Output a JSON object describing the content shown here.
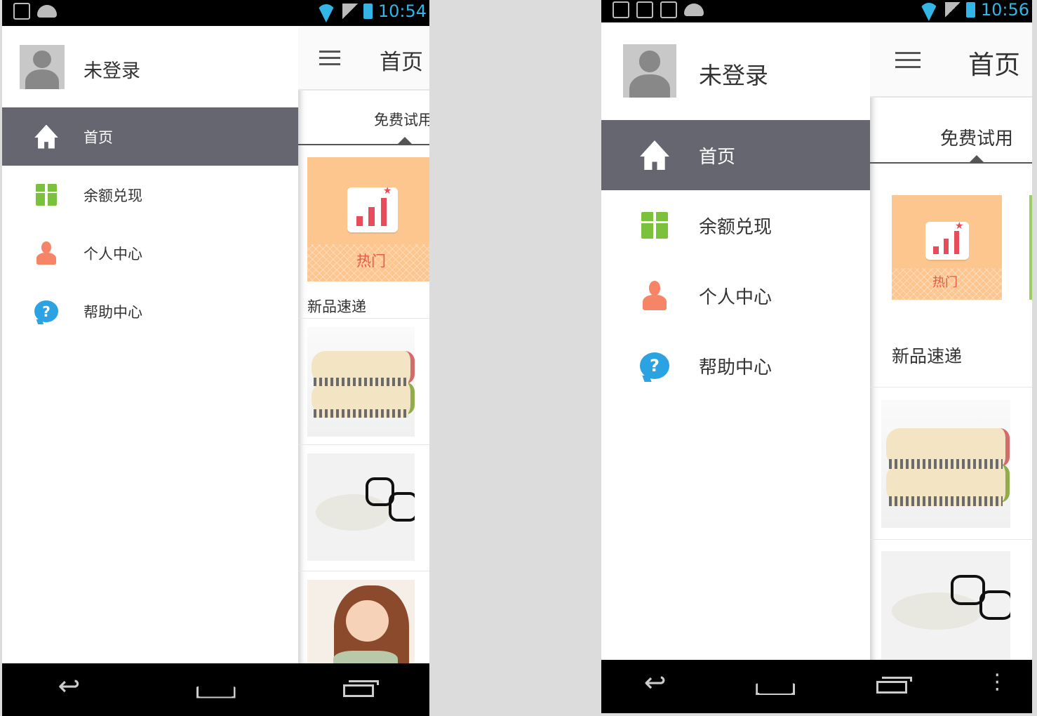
{
  "screens": [
    {
      "status_time": "10:54",
      "drawer": {
        "username": "未登录",
        "items": [
          {
            "label": "首页",
            "icon": "home-icon",
            "active": true
          },
          {
            "label": "余额兑现",
            "icon": "gift-icon",
            "active": false
          },
          {
            "label": "个人中心",
            "icon": "person-icon",
            "active": false
          },
          {
            "label": "帮助中心",
            "icon": "help-icon",
            "active": false
          }
        ]
      },
      "content": {
        "title": "首页",
        "tab_label": "免费试用",
        "hot_label": "热门",
        "section_title": "新品速递"
      }
    },
    {
      "status_time": "10:56",
      "drawer": {
        "username": "未登录",
        "items": [
          {
            "label": "首页",
            "icon": "home-icon",
            "active": true
          },
          {
            "label": "余额兑现",
            "icon": "gift-icon",
            "active": false
          },
          {
            "label": "个人中心",
            "icon": "person-icon",
            "active": false
          },
          {
            "label": "帮助中心",
            "icon": "help-icon",
            "active": false
          }
        ]
      },
      "content": {
        "title": "首页",
        "tab_label": "免费试用",
        "hot_label": "热门",
        "section_title": "新品速递"
      }
    }
  ],
  "colors": {
    "status_accent": "#33b5e5",
    "active_item_bg": "#666670",
    "hot_card_bg": "#fdc68f",
    "gift_green": "#7cc13b",
    "person_orange": "#f58566",
    "help_blue": "#2ba3e3"
  }
}
